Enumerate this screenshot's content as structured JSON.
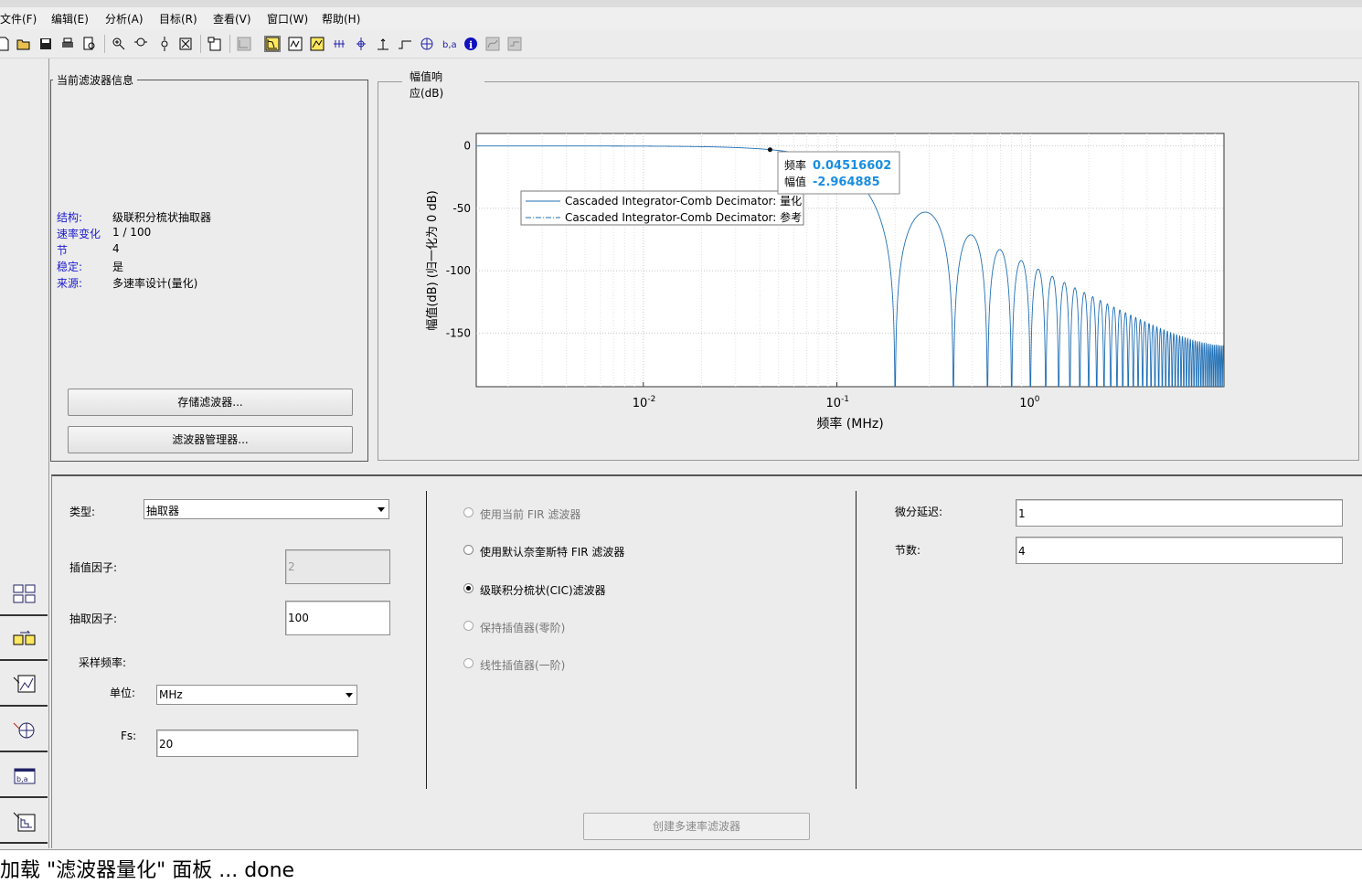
{
  "menu": [
    "文件(F)",
    "编辑(E)",
    "分析(A)",
    "目标(R)",
    "查看(V)",
    "窗口(W)",
    "帮助(H)"
  ],
  "info_panel": {
    "title": "当前滤波器信息",
    "rows": [
      {
        "key": "结构:",
        "value": "级联积分梳状抽取器"
      },
      {
        "key": "速率变化",
        "value": "1 / 100"
      },
      {
        "key": "节",
        "value": "4"
      },
      {
        "key": "稳定:",
        "value": "是"
      },
      {
        "key": "来源:",
        "value": "多速率设计(量化)"
      }
    ],
    "store_button": "存储滤波器...",
    "manager_button": "滤波器管理器..."
  },
  "plot": {
    "title_line1": "幅值响",
    "title_line2": "应(dB)",
    "ylabel": "幅值(dB) (归一化为 0 dB)",
    "xlabel": "频率 (MHz)",
    "yticks": [
      "0",
      "-50",
      "-100",
      "-150"
    ],
    "xticks": [
      {
        "base": "10",
        "exp": "-2"
      },
      {
        "base": "10",
        "exp": "-1"
      },
      {
        "base": "10",
        "exp": "0"
      }
    ],
    "legend": [
      "Cascaded Integrator-Comb Decimator: 量化",
      "Cascaded Integrator-Comb Decimator: 参考"
    ],
    "datatip": {
      "freq_label": "频率",
      "freq_value": "0.04516602",
      "mag_label": "幅值",
      "mag_value": "-2.964885"
    },
    "colors": {
      "line": "#1f6fb5",
      "tip_value": "#1a8ee0"
    }
  },
  "chart_data": {
    "type": "line",
    "xlabel": "频率 (MHz)",
    "ylabel": "幅值(dB) (归一化为 0 dB)",
    "xscale": "log",
    "xlim": [
      0.00137,
      10
    ],
    "ylim": [
      -193,
      10
    ],
    "grid": true,
    "legend_position": "upper-left",
    "series": [
      {
        "name": "Cascaded Integrator-Comb Decimator: 量化",
        "style": "solid",
        "description": "CIC sinc^4 response, R=100, M=1, Fs=20 MHz; nulls at multiples of 0.2 MHz",
        "x": [
          0.00137,
          0.01,
          0.03,
          0.04516602,
          0.06,
          0.08,
          0.1,
          0.15,
          0.2,
          0.29,
          0.4,
          0.5,
          0.6,
          0.7,
          0.8,
          10
        ],
        "y": [
          0,
          -0.15,
          -1.3,
          -2.964885,
          -5.3,
          -9.6,
          -15.6,
          -44,
          -193,
          -53.5,
          -193,
          -71,
          -193,
          -81,
          -193,
          -160
        ]
      },
      {
        "name": "Cascaded Integrator-Comb Decimator: 参考",
        "style": "dashdot",
        "x": [],
        "y": []
      }
    ],
    "annotations": [
      {
        "x": 0.04516602,
        "y": -2.964885,
        "label": "频率 0.04516602 / 幅值 -2.964885"
      }
    ]
  },
  "form": {
    "type_label": "类型:",
    "type_value": "抽取器",
    "interp_label": "插值因子:",
    "interp_value": "2",
    "decim_label": "抽取因子:",
    "decim_value": "100",
    "fs_section": "采样频率:",
    "unit_label": "单位:",
    "unit_value": "MHz",
    "fs_label": "Fs:",
    "fs_value": "20",
    "radios": [
      {
        "label": "使用当前 FIR 滤波器",
        "checked": false,
        "enabled": false
      },
      {
        "label": "使用默认奈奎斯特 FIR 滤波器",
        "checked": false,
        "enabled": true
      },
      {
        "label": "级联积分梳状(CIC)滤波器",
        "checked": true,
        "enabled": true
      },
      {
        "label": "保持插值器(零阶)",
        "checked": false,
        "enabled": false
      },
      {
        "label": "线性插值器(一阶)",
        "checked": false,
        "enabled": false
      }
    ],
    "diff_delay_label": "微分延迟:",
    "diff_delay_value": "1",
    "sections_label": "节数:",
    "sections_value": "4",
    "create_button": "创建多速率滤波器"
  },
  "status": "加载 \"滤波器量化\" 面板 ... done"
}
